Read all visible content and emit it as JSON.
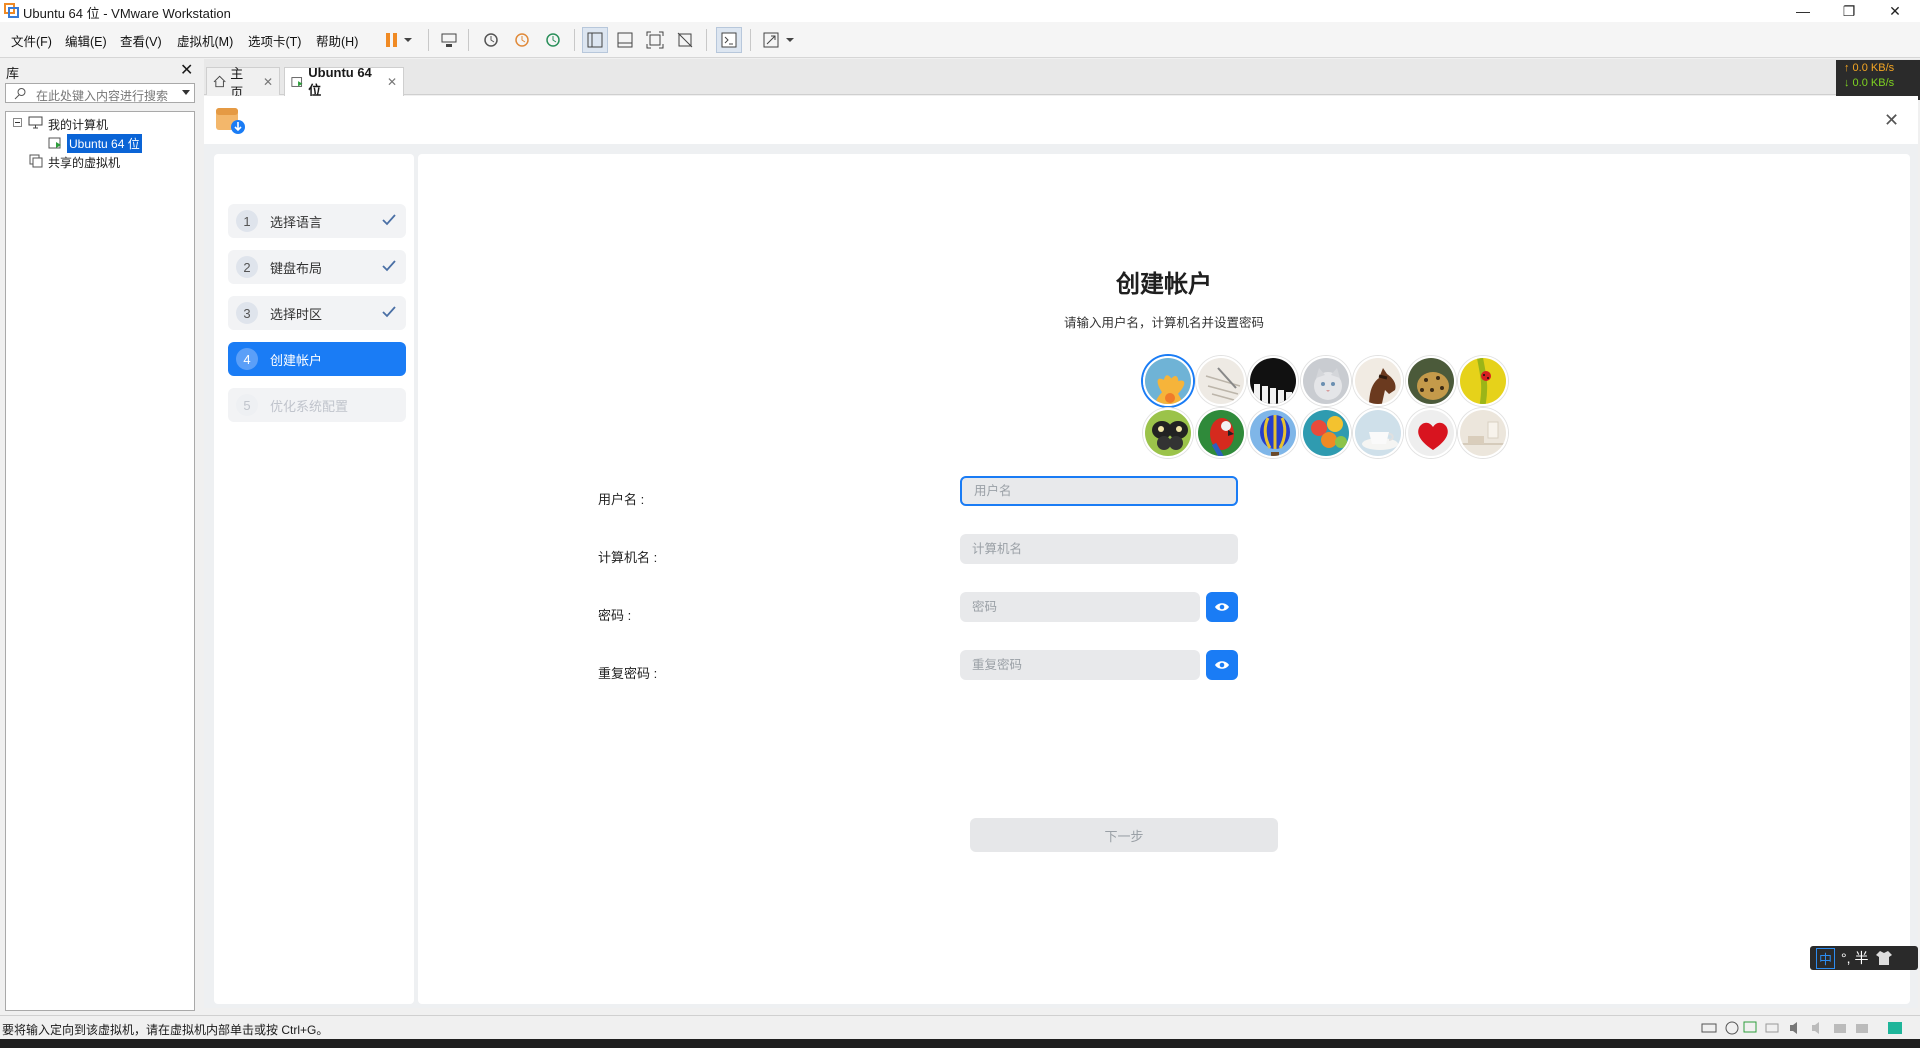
{
  "window": {
    "title": "Ubuntu 64 位 - VMware Workstation",
    "controls": {
      "minimize": "—",
      "restore": "❐",
      "close": "✕"
    }
  },
  "menu": {
    "items": [
      "文件(F)",
      "编辑(E)",
      "查看(V)",
      "虚拟机(M)",
      "选项卡(T)",
      "帮助(H)"
    ]
  },
  "library": {
    "title": "库",
    "close": "✕",
    "search_placeholder": "在此处键入内容进行搜索",
    "tree": {
      "my_computer": "我的计算机",
      "vm": "Ubuntu 64 位",
      "shared": "共享的虚拟机"
    }
  },
  "tabs": [
    {
      "label": "主页",
      "close": "✕"
    },
    {
      "label": "Ubuntu 64 位",
      "close": "✕"
    }
  ],
  "network": {
    "up": "↑ 0.0 KB/s",
    "down": "↓ 0.0 KB/s"
  },
  "installer": {
    "close": "✕",
    "steps": [
      {
        "num": "1",
        "label": "选择语言",
        "state": "done"
      },
      {
        "num": "2",
        "label": "键盘布局",
        "state": "done"
      },
      {
        "num": "3",
        "label": "选择时区",
        "state": "done"
      },
      {
        "num": "4",
        "label": "创建帐户",
        "state": "active"
      },
      {
        "num": "5",
        "label": "优化系统配置",
        "state": "disabled"
      }
    ],
    "title": "创建帐户",
    "subtitle": "请输入用户名，计算机名并设置密码",
    "avatars": [
      "flower",
      "paper",
      "piano",
      "cat",
      "horse",
      "leopard",
      "ladybug",
      "butterfly",
      "parrot",
      "hot-air-balloon",
      "balloons",
      "teacup",
      "heart",
      "room"
    ],
    "fields": {
      "username": {
        "label": "用户名 :",
        "placeholder": "用户名",
        "value": ""
      },
      "hostname": {
        "label": "计算机名 :",
        "placeholder": "计算机名",
        "value": ""
      },
      "password": {
        "label": "密码 :",
        "placeholder": "密码",
        "value": ""
      },
      "repeat_password": {
        "label": "重复密码 :",
        "placeholder": "重复密码",
        "value": ""
      }
    },
    "next_button": "下一步"
  },
  "ime": {
    "lang": "中",
    "punct": "°,",
    "width": "半"
  },
  "statusbar": {
    "message": "要将输入定向到该虚拟机，请在虚拟机内部单击或按 Ctrl+G。"
  },
  "colors": {
    "accent": "#1a7cf5",
    "pause": "#f08a24"
  }
}
